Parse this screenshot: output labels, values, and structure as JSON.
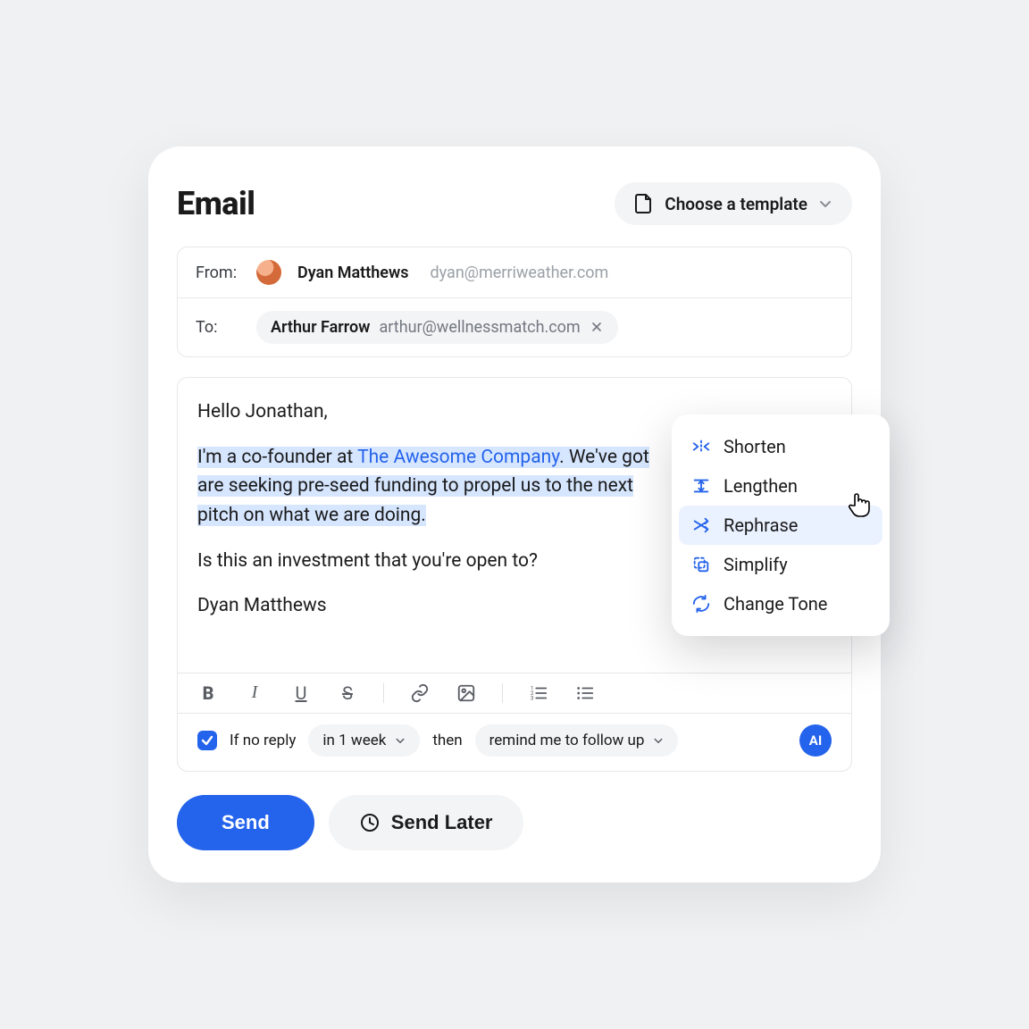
{
  "header": {
    "title": "Email",
    "template_button": "Choose a template"
  },
  "from": {
    "label": "From:",
    "name": "Dyan Matthews",
    "email": "dyan@merriweather.com"
  },
  "to": {
    "label": "To:",
    "chip": {
      "name": "Arthur Farrow",
      "email": "arthur@wellnessmatch.com"
    }
  },
  "body": {
    "greeting": "Hello Jonathan,",
    "p1_a": "I'm a co-founder at ",
    "p1_company": "The Awesome Company",
    "p1_b": ". We've got",
    "p2": "are seeking pre-seed funding to propel us to the next",
    "p3": "pitch on what we are doing.",
    "q": "Is this an investment that you're open to?",
    "sig": "Dyan Matthews"
  },
  "toolbar": {
    "bold": "B",
    "italic": "I",
    "underline": "U",
    "strike": "S"
  },
  "followup": {
    "if_no_reply": "If no reply",
    "in_1_week": "in 1 week",
    "then": "then",
    "remind": "remind me to follow up",
    "ai": "AI"
  },
  "actions": {
    "send": "Send",
    "send_later": "Send Later"
  },
  "ai_menu": {
    "items": [
      {
        "label": "Shorten"
      },
      {
        "label": "Lengthen"
      },
      {
        "label": "Rephrase"
      },
      {
        "label": "Simplify"
      },
      {
        "label": "Change Tone"
      }
    ],
    "hovered_index": 2
  }
}
